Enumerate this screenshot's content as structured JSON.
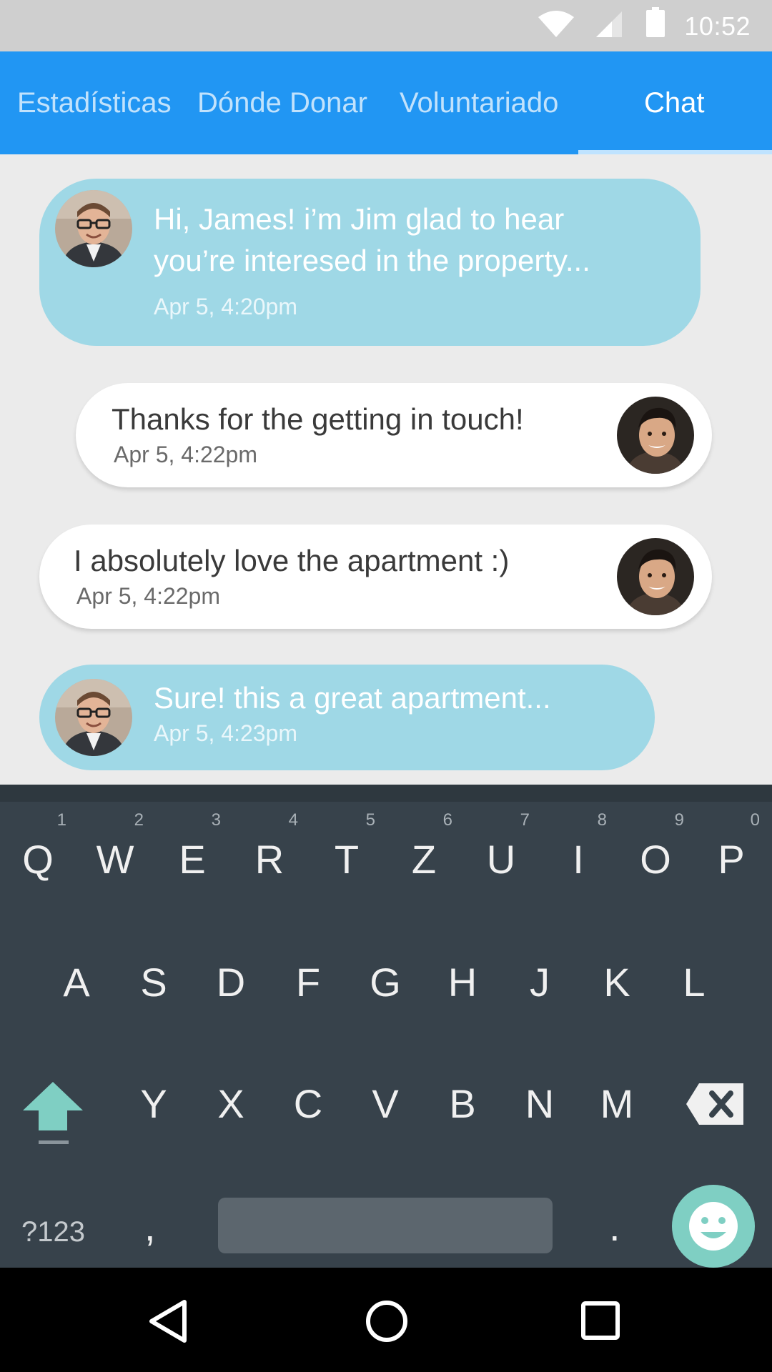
{
  "status_bar": {
    "time": "10:52",
    "icons": [
      "wifi-icon",
      "cellular-signal-icon",
      "battery-icon"
    ]
  },
  "tabs": [
    {
      "label": "Estadísticas",
      "active": false
    },
    {
      "label": "Dónde Donar",
      "active": false
    },
    {
      "label": "Voluntariado",
      "active": false
    },
    {
      "label": "Chat",
      "active": true
    }
  ],
  "messages": [
    {
      "sender": "Jim",
      "direction": "incoming",
      "text": "Hi, James! i’m Jim glad to hear\nyou’re interesed in the property...",
      "time": "Apr 5, 4:20pm"
    },
    {
      "sender": "James",
      "direction": "outgoing",
      "text": "Thanks for the getting in touch!",
      "time": "Apr 5, 4:22pm"
    },
    {
      "sender": "James",
      "direction": "outgoing",
      "text": "I absolutely love the apartment  :)",
      "time": "Apr 5, 4:22pm"
    },
    {
      "sender": "Jim",
      "direction": "incoming",
      "text": "Sure! this a great apartment...",
      "time": "Apr 5, 4:23pm"
    }
  ],
  "keyboard": {
    "row1": [
      {
        "key": "Q",
        "hint": "1"
      },
      {
        "key": "W",
        "hint": "2"
      },
      {
        "key": "E",
        "hint": "3"
      },
      {
        "key": "R",
        "hint": "4"
      },
      {
        "key": "T",
        "hint": "5"
      },
      {
        "key": "Z",
        "hint": "6"
      },
      {
        "key": "U",
        "hint": "7"
      },
      {
        "key": "I",
        "hint": "8"
      },
      {
        "key": "O",
        "hint": "9"
      },
      {
        "key": "P",
        "hint": "0"
      }
    ],
    "row2": [
      "A",
      "S",
      "D",
      "F",
      "G",
      "H",
      "J",
      "K",
      "L"
    ],
    "row3": [
      "Y",
      "X",
      "C",
      "V",
      "B",
      "N",
      "M"
    ],
    "symbols_label": "?123",
    "comma": ",",
    "period": ".",
    "accent_color": "#7fcfc3"
  },
  "colors": {
    "app_bar": "#2196f3",
    "incoming_bubble": "#9fd8e6",
    "outgoing_bubble": "#ffffff",
    "keyboard_bg": "#37424b"
  },
  "nav_bar": [
    "back-icon",
    "home-icon",
    "recents-icon"
  ]
}
